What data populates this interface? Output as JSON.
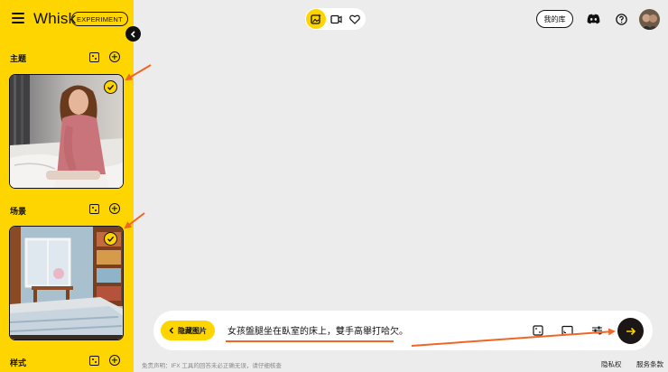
{
  "app": {
    "title": "Whisk",
    "badge": "EXPERIMENT"
  },
  "sidebar": {
    "sections": [
      {
        "title": "主题",
        "selected": true
      },
      {
        "title": "场景",
        "selected": true
      },
      {
        "title": "样式",
        "selected": false
      }
    ]
  },
  "toolbar": {
    "modes": [
      {
        "icon": "image-generate-icon",
        "active": true
      },
      {
        "icon": "video-generate-icon",
        "active": false
      },
      {
        "icon": "heart-icon",
        "active": false
      }
    ],
    "library_label": "我的库",
    "icons": [
      "discord-icon",
      "help-icon"
    ]
  },
  "prompt": {
    "hide_images_label": "隐藏图片",
    "text": "女孩盤腿坐在臥室的床上，雙手高舉打哈欠。",
    "tools": [
      "random-dice-icon",
      "aspect-ratio-icon",
      "settings-sliders-icon"
    ],
    "send_icon": "arrow-right-icon"
  },
  "footer": {
    "disclaimer": "免责声明：IFX 工具的回答未必正确无误，请仔细核查",
    "privacy": "隐私权",
    "terms": "服务条款"
  },
  "colors": {
    "accent": "#ffd500",
    "annotation_arrow": "#f26522",
    "background": "#ececec"
  }
}
